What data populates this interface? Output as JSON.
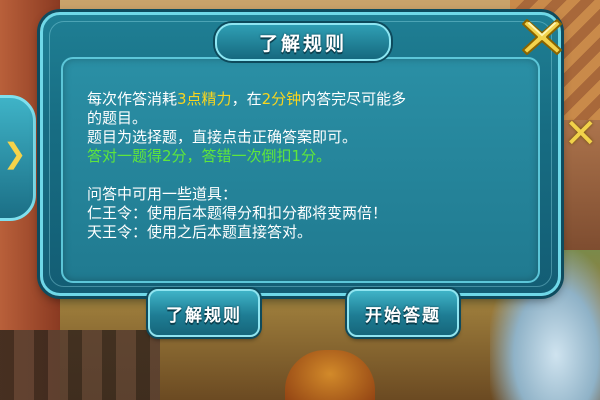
{
  "dialog": {
    "title": "了解规则",
    "close_icon": "close-x-icon",
    "rules": {
      "line1_part1": "每次作答消耗",
      "line1_cost": "3点精力",
      "line1_part2": "，在",
      "line1_time": "2分钟",
      "line1_part3": "内答完尽可能多",
      "line2": "的题目。",
      "line3": "题目为选择题，直接点击正确答案即可。",
      "line4": "答对一题得2分，答错一次倒扣1分。",
      "line5": "问答中可用一些道具：",
      "line6": "仁王令：使用后本题得分和扣分都将变两倍！",
      "line7": "天王令：使用之后本题直接答对。"
    }
  },
  "buttons": {
    "rules_label": "了解规则",
    "start_label": "开始答题"
  },
  "colors": {
    "panel": "#1f7f94",
    "border": "#6fd8e8",
    "highlight_yellow": "#f7d51f",
    "highlight_green": "#5fe63c",
    "close_icon": "#f3d34c"
  },
  "scene": {
    "left_tab_icon": "chevron-right-icon",
    "right_deco_icon": "close-x-icon"
  }
}
